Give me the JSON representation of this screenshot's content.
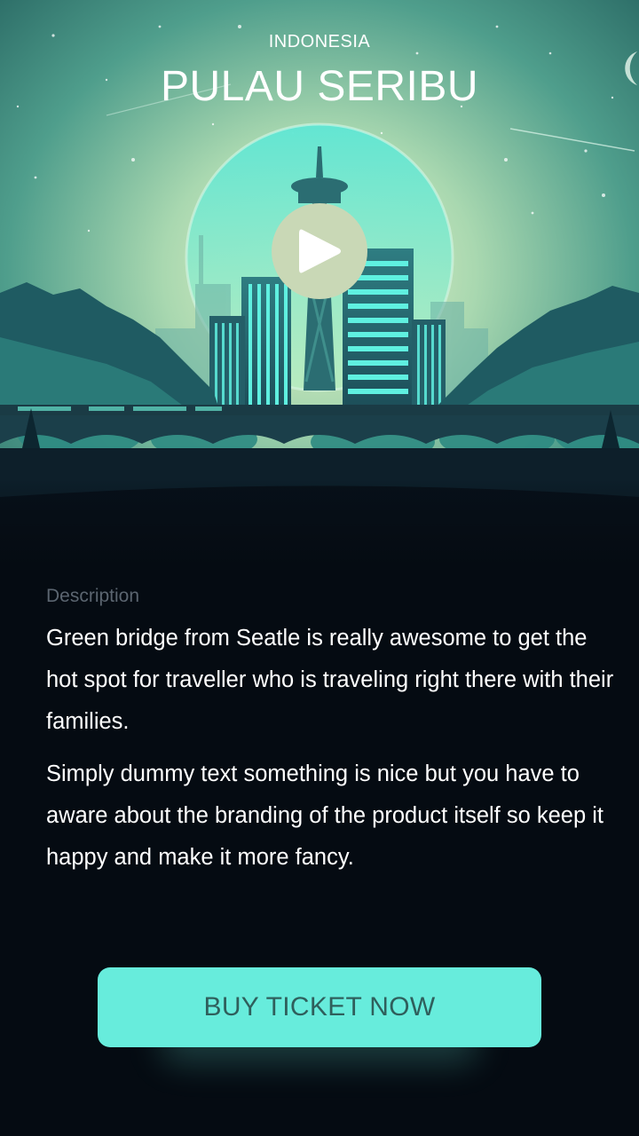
{
  "hero": {
    "country": "INDONESIA",
    "title": "PULAU SERIBU",
    "play_icon": "play-icon"
  },
  "description": {
    "label": "Description",
    "paragraphs": [
      "Green bridge from Seatle is really awesome to get the hot spot for traveller who is traveling right there with their families.",
      "Simply dummy text something is nice but you have to aware about the branding of the product itself so keep it happy and make it more fancy."
    ]
  },
  "cta": {
    "label": "BUY TICKET NOW"
  },
  "colors": {
    "accent": "#67ecdc",
    "background": "#050b12",
    "play_button": "#c9d8b6"
  }
}
